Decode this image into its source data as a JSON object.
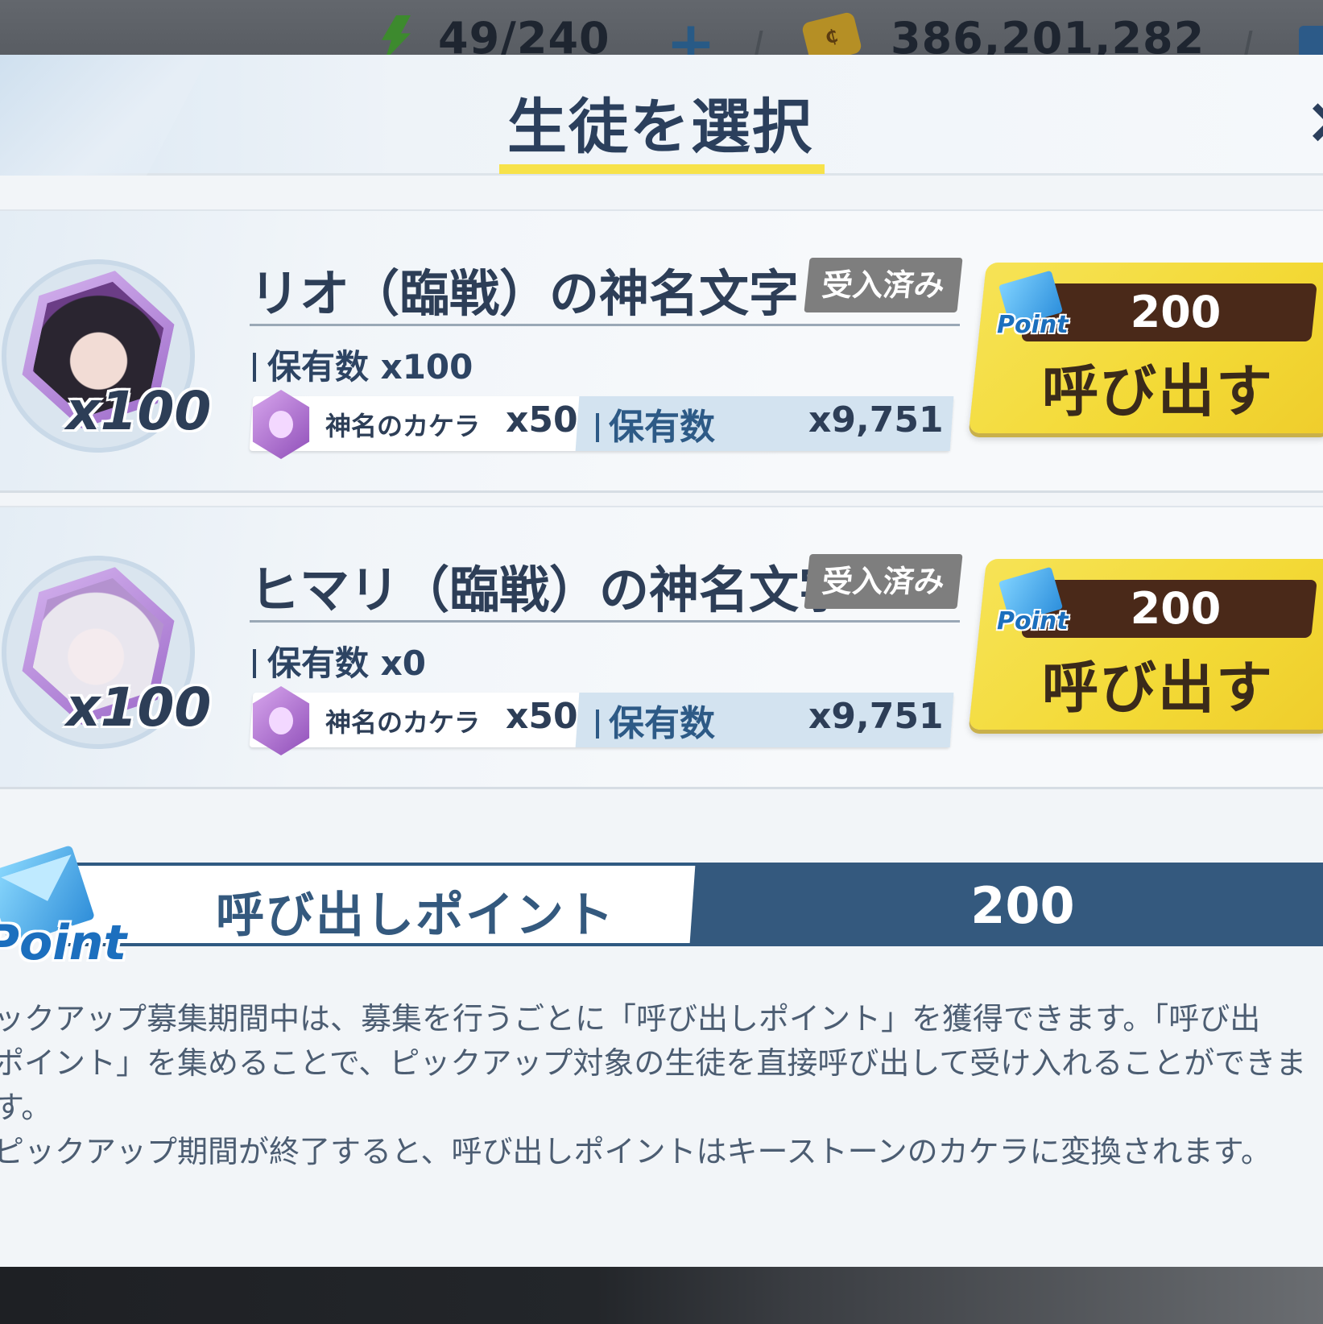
{
  "topbar": {
    "ap": "49/240",
    "credits": "386,201,282"
  },
  "modal": {
    "title": "生徒を選択",
    "close_label": "×"
  },
  "items": [
    {
      "name": "リオ（臨戦）の神名文字",
      "badge": "受入済み",
      "portrait_count": "x100",
      "owned": "保有数 x100",
      "cost_item": "神名のカケラ",
      "cost_qty": "x50",
      "cost_owned_label": "保有数",
      "cost_owned_value": "x9,751",
      "summon_price": "200",
      "point_tag": "Point",
      "summon_label": "呼び出す"
    },
    {
      "name": "ヒマリ（臨戦）の神名文字",
      "badge": "受入済み",
      "portrait_count": "x100",
      "owned": "保有数 x0",
      "cost_item": "神名のカケラ",
      "cost_qty": "x50",
      "cost_owned_label": "保有数",
      "cost_owned_value": "x9,751",
      "summon_price": "200",
      "point_tag": "Point",
      "summon_label": "呼び出す"
    }
  ],
  "points": {
    "icon_text": "Point",
    "label": "呼び出しポイント",
    "value": "200"
  },
  "description": [
    "ックアップ募集期間中は、募集を行うごとに「呼び出しポイント」を獲得できます。「呼び出",
    "ポイント」を集めることで、ピックアップ対象の生徒を直接呼び出して受け入れることができま",
    "す。",
    "ピックアップ期間が終了すると、呼び出しポイントはキーストーンのカケラに変換されます。"
  ],
  "colors": {
    "accent_yellow": "#f7e24a",
    "navy": "#34597e",
    "price_bar": "#4a2919",
    "badge_gray": "#7e7e7e"
  }
}
